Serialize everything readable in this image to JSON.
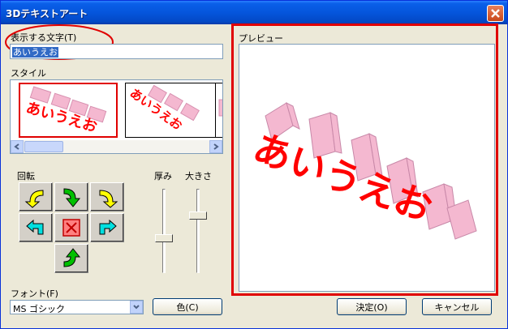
{
  "window": {
    "title": "3Dテキストアート"
  },
  "text_field": {
    "label": "表示する文字(T)",
    "value": "あいうえお"
  },
  "style": {
    "label": "スタイル",
    "thumbnails": [
      {
        "text": "あいうえお",
        "selected": true
      },
      {
        "text": "あいうえお",
        "selected": false
      },
      {
        "text": "",
        "selected": false
      }
    ]
  },
  "rotation": {
    "label": "回転"
  },
  "thickness": {
    "label": "厚み",
    "level": 0.6
  },
  "size": {
    "label": "大きさ",
    "level": 0.3
  },
  "font": {
    "label": "フォント(F)",
    "value": "MS ゴシック"
  },
  "buttons": {
    "color": "色(C)",
    "ok": "決定(O)",
    "cancel": "キャンセル"
  },
  "preview": {
    "label": "プレビュー",
    "text": "あいうえお"
  },
  "colors": {
    "accent_red": "#e00000",
    "text_red": "#ff0000",
    "extrude_pink": "#f4b8d0",
    "arrow_yellow": "#ffff00",
    "arrow_green": "#00c000",
    "arrow_cyan": "#00e0e0"
  }
}
